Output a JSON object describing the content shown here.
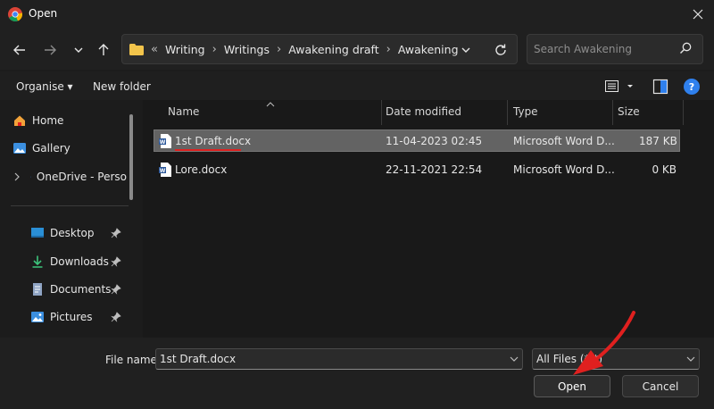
{
  "window": {
    "title": "Open"
  },
  "address": {
    "overflow": "«",
    "segments": [
      "Writing",
      "Writings",
      "Awakening draft",
      "Awakening"
    ]
  },
  "search": {
    "placeholder": "Search Awakening"
  },
  "toolbar": {
    "organise": "Organise ▾",
    "new_folder": "New folder"
  },
  "sidebar": {
    "items": [
      {
        "label": "Home",
        "icon": "home-icon"
      },
      {
        "label": "Gallery",
        "icon": "gallery-icon"
      },
      {
        "label": "OneDrive - Perso",
        "icon": "cloud-icon"
      },
      {
        "label": "Desktop",
        "icon": "desktop-icon",
        "pinned": true
      },
      {
        "label": "Downloads",
        "icon": "download-icon",
        "pinned": true
      },
      {
        "label": "Documents",
        "icon": "documents-icon",
        "pinned": true
      },
      {
        "label": "Pictures",
        "icon": "pictures-icon",
        "pinned": true
      }
    ]
  },
  "table": {
    "columns": [
      "Name",
      "Date modified",
      "Type",
      "Size"
    ],
    "rows": [
      {
        "name": "1st Draft.docx",
        "date": "11-04-2023 02:45",
        "type": "Microsoft Word D...",
        "size": "187 KB",
        "selected": true
      },
      {
        "name": "Lore.docx",
        "date": "22-11-2021 22:54",
        "type": "Microsoft Word D...",
        "size": "0 KB",
        "selected": false
      }
    ]
  },
  "footer": {
    "file_name_label": "File name:",
    "file_name_value": "1st Draft.docx",
    "filter": "All Files (*.*)",
    "open": "Open",
    "cancel": "Cancel"
  },
  "colors": {
    "accent": "#2f80ed",
    "annotation": "#e0201f",
    "selected_row": "#636363"
  }
}
